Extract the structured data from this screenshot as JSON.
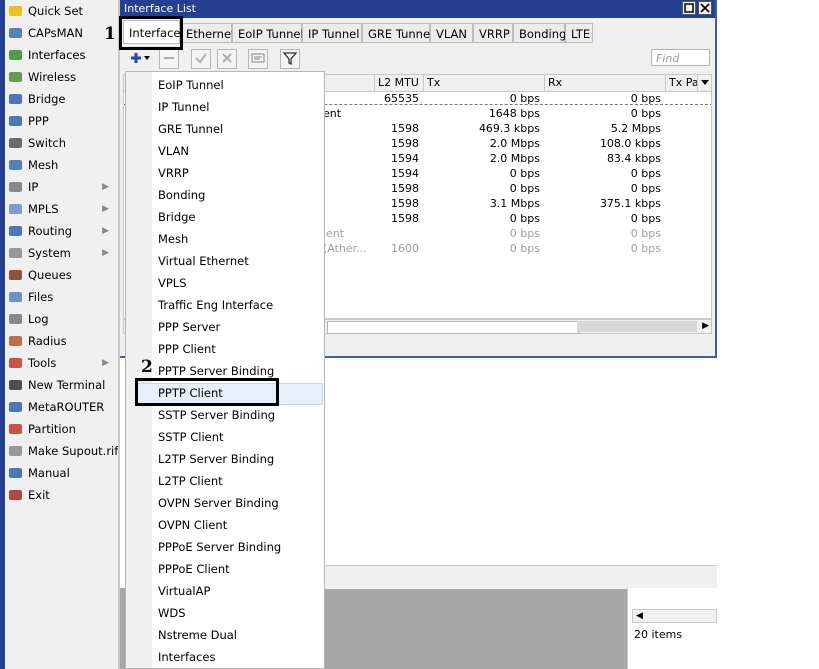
{
  "sidebar": {
    "items": [
      {
        "label": "Quick Set",
        "icon": "quick-set-icon",
        "submenu": false
      },
      {
        "label": "CAPsMAN",
        "icon": "capsman-icon",
        "submenu": false
      },
      {
        "label": "Interfaces",
        "icon": "interfaces-icon",
        "submenu": false
      },
      {
        "label": "Wireless",
        "icon": "wireless-icon",
        "submenu": false
      },
      {
        "label": "Bridge",
        "icon": "bridge-icon",
        "submenu": false
      },
      {
        "label": "PPP",
        "icon": "ppp-icon",
        "submenu": false
      },
      {
        "label": "Switch",
        "icon": "switch-icon",
        "submenu": false
      },
      {
        "label": "Mesh",
        "icon": "mesh-icon",
        "submenu": false
      },
      {
        "label": "IP",
        "icon": "ip-icon",
        "submenu": true
      },
      {
        "label": "MPLS",
        "icon": "mpls-icon",
        "submenu": true
      },
      {
        "label": "Routing",
        "icon": "routing-icon",
        "submenu": true
      },
      {
        "label": "System",
        "icon": "system-icon",
        "submenu": true
      },
      {
        "label": "Queues",
        "icon": "queues-icon",
        "submenu": false
      },
      {
        "label": "Files",
        "icon": "files-icon",
        "submenu": false
      },
      {
        "label": "Log",
        "icon": "log-icon",
        "submenu": false
      },
      {
        "label": "Radius",
        "icon": "radius-icon",
        "submenu": false
      },
      {
        "label": "Tools",
        "icon": "tools-icon",
        "submenu": true
      },
      {
        "label": "New Terminal",
        "icon": "terminal-icon",
        "submenu": false
      },
      {
        "label": "MetaROUTER",
        "icon": "metarouter-icon",
        "submenu": false
      },
      {
        "label": "Partition",
        "icon": "partition-icon",
        "submenu": false
      },
      {
        "label": "Make Supout.rif",
        "icon": "supout-icon",
        "submenu": false
      },
      {
        "label": "Manual",
        "icon": "manual-icon",
        "submenu": false
      },
      {
        "label": "Exit",
        "icon": "exit-icon",
        "submenu": false
      }
    ]
  },
  "window": {
    "title": "Interface List",
    "tabs": [
      "Interface",
      "Ethernet",
      "EoIP Tunnel",
      "IP Tunnel",
      "GRE Tunnel",
      "VLAN",
      "VRRP",
      "Bonding",
      "LTE"
    ],
    "active_tab": "Interface",
    "find_placeholder": "Find",
    "columns": [
      "L2 MTU",
      "Tx",
      "Rx",
      "Tx Pa"
    ],
    "rows": [
      {
        "name": "",
        "mtu": "65535",
        "tx": "0 bps",
        "rx": "0 bps",
        "dim": false
      },
      {
        "name": "ent",
        "mtu": "",
        "tx": "1648 bps",
        "rx": "0 bps",
        "dim": false
      },
      {
        "name": "",
        "mtu": "1598",
        "tx": "469.3 kbps",
        "rx": "5.2 Mbps",
        "dim": false
      },
      {
        "name": "",
        "mtu": "1598",
        "tx": "2.0 Mbps",
        "rx": "108.0 kbps",
        "dim": false
      },
      {
        "name": "",
        "mtu": "1594",
        "tx": "2.0 Mbps",
        "rx": "83.4 kbps",
        "dim": false
      },
      {
        "name": "",
        "mtu": "1594",
        "tx": "0 bps",
        "rx": "0 bps",
        "dim": false
      },
      {
        "name": "",
        "mtu": "1598",
        "tx": "0 bps",
        "rx": "0 bps",
        "dim": false
      },
      {
        "name": "",
        "mtu": "1598",
        "tx": "3.1 Mbps",
        "rx": "375.1 kbps",
        "dim": false
      },
      {
        "name": "",
        "mtu": "1598",
        "tx": "0 bps",
        "rx": "0 bps",
        "dim": false
      },
      {
        "name": "ient",
        "mtu": "",
        "tx": "0 bps",
        "rx": "0 bps",
        "dim": true
      },
      {
        "name": "(Ather...",
        "mtu": "1600",
        "tx": "0 bps",
        "rx": "0 bps",
        "dim": true
      }
    ]
  },
  "menu": {
    "items": [
      "EoIP Tunnel",
      "IP Tunnel",
      "GRE Tunnel",
      "VLAN",
      "VRRP",
      "Bonding",
      "Bridge",
      "Mesh",
      "Virtual Ethernet",
      "VPLS",
      "Traffic Eng Interface",
      "PPP Server",
      "PPP Client",
      "PPTP Server Binding",
      "PPTP Client",
      "SSTP Server Binding",
      "SSTP Client",
      "L2TP Server Binding",
      "L2TP Client",
      "OVPN Server Binding",
      "OVPN Client",
      "PPPoE Server Binding",
      "PPPoE Client",
      "VirtualAP",
      "WDS",
      "Nstreme Dual",
      "Interfaces"
    ],
    "highlighted": "PPTP Client"
  },
  "lower_window": {
    "items_count": "20 items"
  },
  "annotations": {
    "step1": "1",
    "step2": "2"
  },
  "colors": {
    "titlebar": "#24408f",
    "sidebar_bg": "#f0f0f0",
    "highlight": "#e5f0fb"
  }
}
